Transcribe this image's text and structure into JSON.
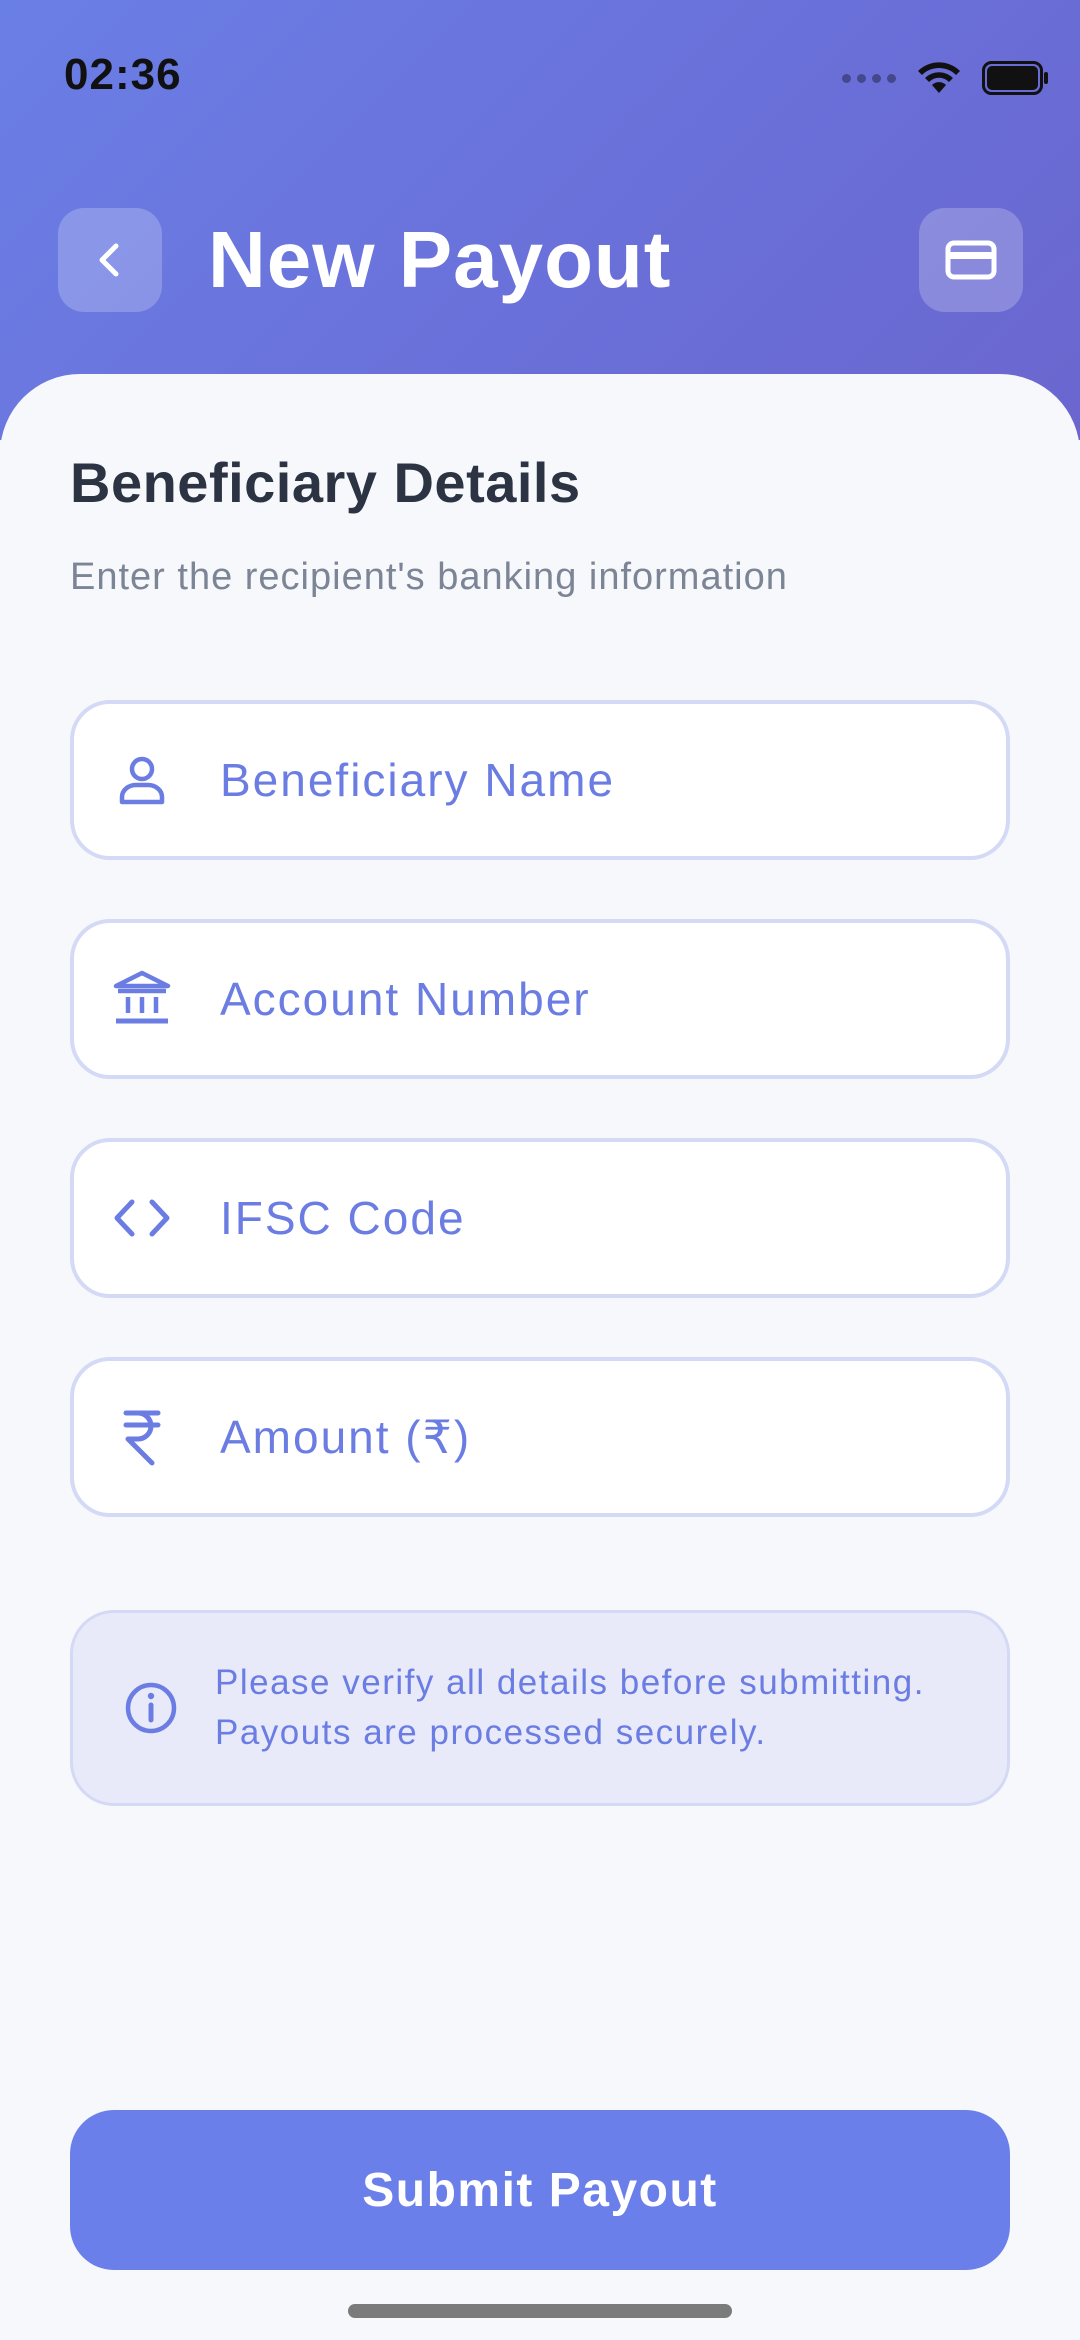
{
  "status_bar": {
    "time": "02:36"
  },
  "header": {
    "title": "New Payout",
    "back_icon": "chevron-left-icon",
    "card_icon": "credit-card-icon"
  },
  "section": {
    "title": "Beneficiary Details",
    "subtitle": "Enter the recipient's banking information"
  },
  "fields": [
    {
      "icon": "user-icon",
      "placeholder": "Beneficiary Name"
    },
    {
      "icon": "bank-icon",
      "placeholder": "Account Number"
    },
    {
      "icon": "code-icon",
      "placeholder": "IFSC Code"
    },
    {
      "icon": "rupee-icon",
      "placeholder": "Amount (₹)"
    }
  ],
  "info": {
    "icon": "info-icon",
    "line1": "Please verify all details before submitting.",
    "line2": "Payouts are processed securely."
  },
  "submit": {
    "label": "Submit Payout"
  },
  "colors": {
    "header_gradient_start": "#6a7fe6",
    "header_gradient_end": "#6b66cf",
    "accent": "#6a7fe9",
    "field_border": "#d4d9f6",
    "info_background": "#e8eaf9",
    "title_text": "#2c3444",
    "subtitle_text": "#7c8596"
  }
}
